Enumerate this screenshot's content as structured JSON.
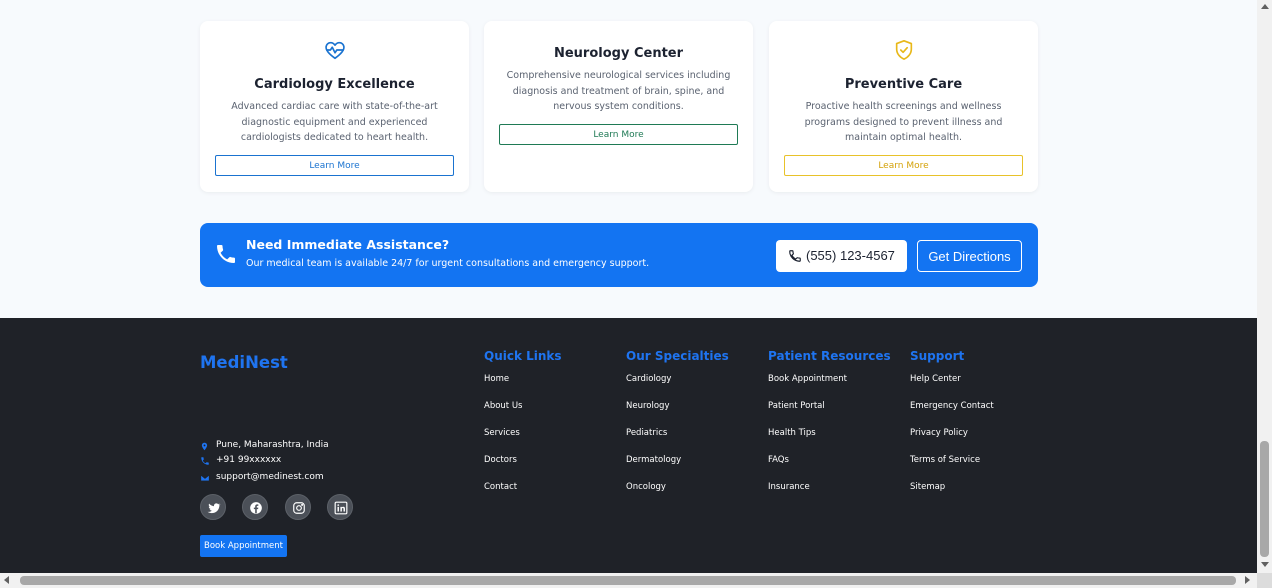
{
  "services": [
    {
      "title": "Cardiology Excellence",
      "description": "Advanced cardiac care with state-of-the-art diagnostic equipment and experienced cardiologists dedicated to heart health.",
      "button_label": "Learn More",
      "icon": "heart-pulse-icon",
      "accent": "#1a73d0"
    },
    {
      "title": "Neurology Center",
      "description": "Comprehensive neurological services including diagnosis and treatment of brain, spine, and nervous system conditions.",
      "button_label": "Learn More",
      "accent": "#1f7a55"
    },
    {
      "title": "Preventive Care",
      "description": "Proactive health screenings and wellness programs designed to prevent illness and maintain optimal health.",
      "button_label": "Learn More",
      "icon": "shield-check-icon",
      "accent": "#e8c22a"
    }
  ],
  "assistance": {
    "title": "Need Immediate Assistance?",
    "subtitle": "Our medical team is available 24/7 for urgent consultations and emergency support.",
    "phone_label": "(555) 123-4567",
    "directions_label": "Get Directions",
    "background": "#1374f2"
  },
  "footer": {
    "brand": "MediNest",
    "contact": {
      "address": "Pune, Maharashtra, India",
      "phone": "+91 99xxxxxx",
      "email": "support@medinest.com"
    },
    "social": [
      "twitter-icon",
      "facebook-icon",
      "instagram-icon",
      "linkedin-icon"
    ],
    "book_label": "Book Appointment",
    "columns": [
      {
        "title": "Quick Links",
        "items": [
          "Home",
          "About Us",
          "Services",
          "Doctors",
          "Contact"
        ]
      },
      {
        "title": "Our Specialties",
        "items": [
          "Cardiology",
          "Neurology",
          "Pediatrics",
          "Dermatology",
          "Oncology"
        ]
      },
      {
        "title": "Patient Resources",
        "items": [
          "Book Appointment",
          "Patient Portal",
          "Health Tips",
          "FAQs",
          "Insurance"
        ]
      },
      {
        "title": "Support",
        "items": [
          "Help Center",
          "Emergency Contact",
          "Privacy Policy",
          "Terms of Service",
          "Sitemap"
        ]
      }
    ],
    "background": "#1f2228",
    "accent": "#1f74f0"
  }
}
